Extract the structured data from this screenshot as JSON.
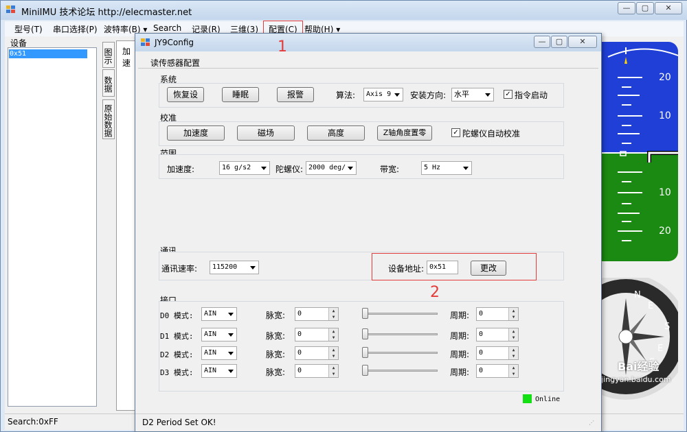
{
  "window": {
    "title": "MiniIMU 技术论坛 http://elecmaster.net",
    "status": "Search:0xFF"
  },
  "menu": [
    "型号(T)",
    "串口选择(P)",
    "波特率(B) ▾",
    "Search",
    "记录(R)",
    "三维(3)",
    "配置(C)",
    "帮助(H) ▾"
  ],
  "sidebar": {
    "title": "设备",
    "device": "0x51"
  },
  "tabs": [
    "图示",
    "数据",
    "原始数据"
  ],
  "tab_content": "加速",
  "dialog": {
    "title": "JY9Config",
    "read_button": "读传感器配置",
    "system": {
      "label": "系统",
      "restore": "恢复设",
      "sleep": "睡眠",
      "alarm": "报警",
      "algo_label": "算法:",
      "algo_value": "Axis 9",
      "orient_label": "安装方向:",
      "orient_value": "水平",
      "cmd_start": "指令启动"
    },
    "calib": {
      "label": "校准",
      "acc": "加速度",
      "mag": "磁场",
      "height": "高度",
      "zero_z": "Z轴角度置零",
      "auto_gyro": "陀螺仪自动校准"
    },
    "range": {
      "label": "范围",
      "acc_label": "加速度:",
      "acc_value": "16 g/s2",
      "gyro_label": "陀螺仪:",
      "gyro_value": "2000 deg/",
      "bw_label": "带宽:",
      "bw_value": "5    Hz"
    },
    "comm": {
      "label": "通讯",
      "baud_label": "通讯速率:",
      "baud_value": "115200",
      "addr_label": "设备地址:",
      "addr_value": "0x51",
      "change": "更改"
    },
    "port": {
      "label": "接口",
      "rows": [
        {
          "name": "D0 模式:",
          "mode": "AIN",
          "pulse_label": "脉宽:",
          "pulse": "0",
          "period_label": "周期:",
          "period": "0"
        },
        {
          "name": "D1 模式:",
          "mode": "AIN",
          "pulse_label": "脉宽:",
          "pulse": "0",
          "period_label": "周期:",
          "period": "0"
        },
        {
          "name": "D2 模式:",
          "mode": "AIN",
          "pulse_label": "脉宽:",
          "pulse": "0",
          "period_label": "周期:",
          "period": "0"
        },
        {
          "name": "D3 模式:",
          "mode": "AIN",
          "pulse_label": "脉宽:",
          "pulse": "0",
          "period_label": "周期:",
          "period": "0"
        }
      ]
    },
    "online": "Online",
    "status": "D2  Period Set OK!"
  },
  "annotations": {
    "one": "1",
    "two": "2"
  },
  "attitude": {
    "ticks": [
      "20",
      "10",
      "10",
      "20"
    ]
  },
  "compass": {
    "labels": [
      "N",
      "E",
      "S",
      "E",
      "S"
    ]
  },
  "watermark": {
    "brand": "Bai",
    "brand2": "经验",
    "url": "jingyan.baidu.com"
  },
  "colors": {
    "sky": "#1f3fd6",
    "ground": "#1a8a12",
    "annotation": "#e43a3a",
    "online": "#12e012"
  }
}
